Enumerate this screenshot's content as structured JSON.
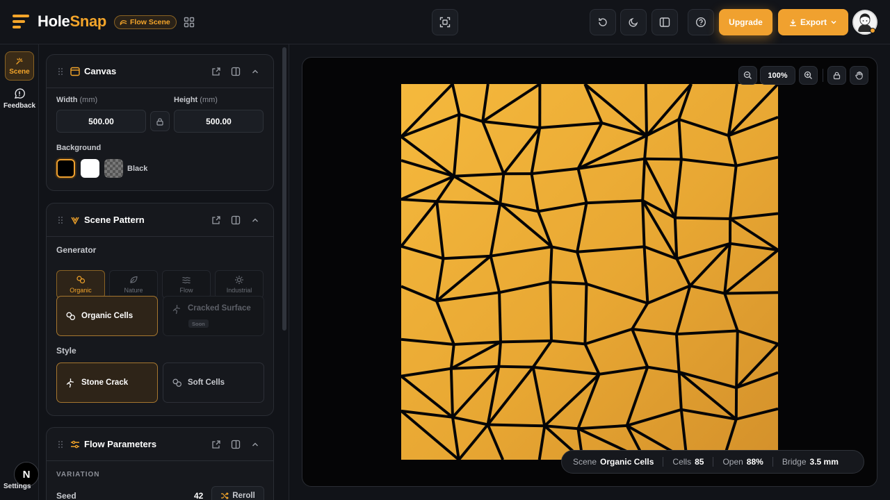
{
  "header": {
    "logo_main": "Hole",
    "logo_accent": "Snap",
    "mode_pill": "Flow Scene",
    "upgrade_label": "Upgrade",
    "export_label": "Export"
  },
  "rail": {
    "scene_label": "Scene",
    "feedback_label": "Feedback",
    "settings_label": "Settings",
    "badge_letter": "N"
  },
  "canvas_card": {
    "title": "Canvas",
    "width_label": "Width",
    "height_label": "Height",
    "unit": "(mm)",
    "width_value": "500.00",
    "height_value": "500.00",
    "background_label": "Background",
    "background_selected": "Black",
    "swatch_colors": [
      "#000000",
      "#ffffff"
    ]
  },
  "scene_card": {
    "title": "Scene Pattern",
    "generator_label": "Generator",
    "generators": [
      "Organic",
      "Nature",
      "Flow",
      "Industrial"
    ],
    "patterns": [
      {
        "label": "Organic Cells",
        "state": "active"
      },
      {
        "label": "Cracked Surface",
        "state": "disabled",
        "badge": "Soon"
      }
    ],
    "style_label": "Style",
    "styles": [
      {
        "label": "Stone Crack",
        "state": "active"
      },
      {
        "label": "Soft Cells",
        "state": "normal"
      }
    ]
  },
  "flow_card": {
    "title": "Flow Parameters",
    "section_label": "VARIATION",
    "seed_label": "Seed",
    "seed_value": "42",
    "reroll_label": "Reroll"
  },
  "viewport": {
    "zoom": "100%",
    "artboard_color": "#e8a733"
  },
  "status": {
    "scene_label": "Scene",
    "scene_value": "Organic Cells",
    "cells_label": "Cells",
    "cells_value": "85",
    "open_label": "Open",
    "open_value": "88%",
    "bridge_label": "Bridge",
    "bridge_value": "3.5 mm"
  },
  "colors": {
    "accent": "#f0a12f",
    "background": "#111318",
    "panel": "#16181d"
  }
}
